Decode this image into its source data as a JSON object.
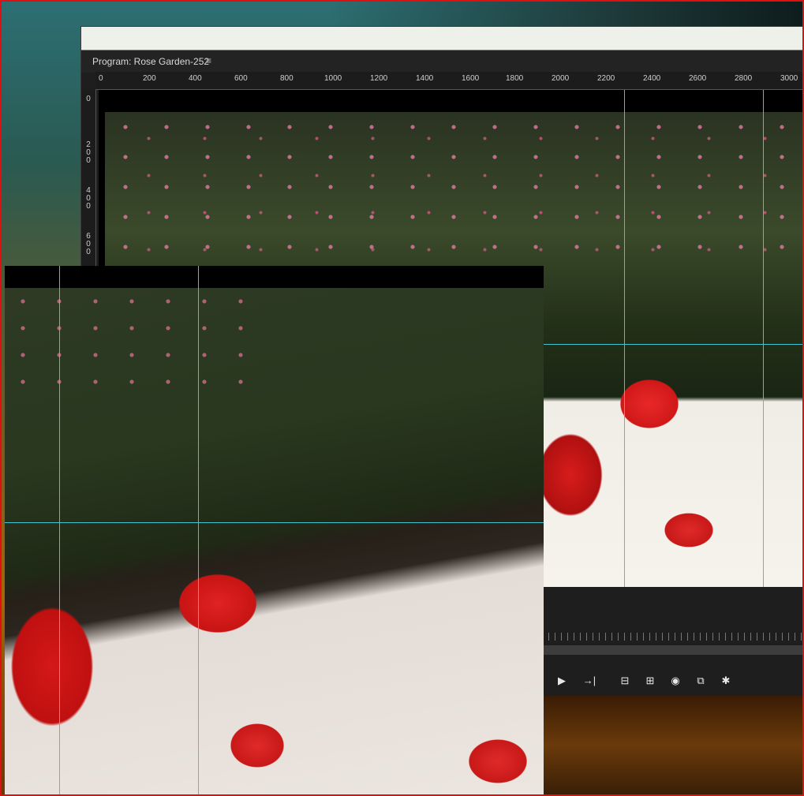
{
  "monitor": {
    "title": "Program: Rose Garden-252",
    "menu_icon": "hamburger-menu-icon"
  },
  "ruler": {
    "horizontal_labels": [
      "0",
      "200",
      "400",
      "600",
      "800",
      "1000",
      "1200",
      "1400",
      "1600",
      "1800",
      "2000",
      "2200",
      "2400",
      "2600",
      "2800",
      "3000"
    ],
    "vertical_labels": [
      "0",
      "2\n0\n0",
      "4\n0\n0",
      "6\n0\n0"
    ]
  },
  "controls": {
    "buttons": [
      {
        "name": "play-button",
        "icon": "play-icon",
        "glyph": "▶"
      },
      {
        "name": "step-forward-button",
        "icon": "step-forward-icon",
        "glyph": "→|"
      },
      {
        "name": "lift-button",
        "icon": "lift-icon",
        "glyph": "⊟"
      },
      {
        "name": "extract-button",
        "icon": "extract-icon",
        "glyph": "⊞"
      },
      {
        "name": "export-frame-button",
        "icon": "camera-icon",
        "glyph": "◉"
      },
      {
        "name": "comparison-view-button",
        "icon": "comparison-icon",
        "glyph": "⧉"
      },
      {
        "name": "settings-button",
        "icon": "wrench-icon",
        "glyph": "✱"
      }
    ]
  },
  "colors": {
    "accent_border": "#e01010",
    "guide": "#3fc4d0",
    "panel": "#1e1e1e"
  }
}
